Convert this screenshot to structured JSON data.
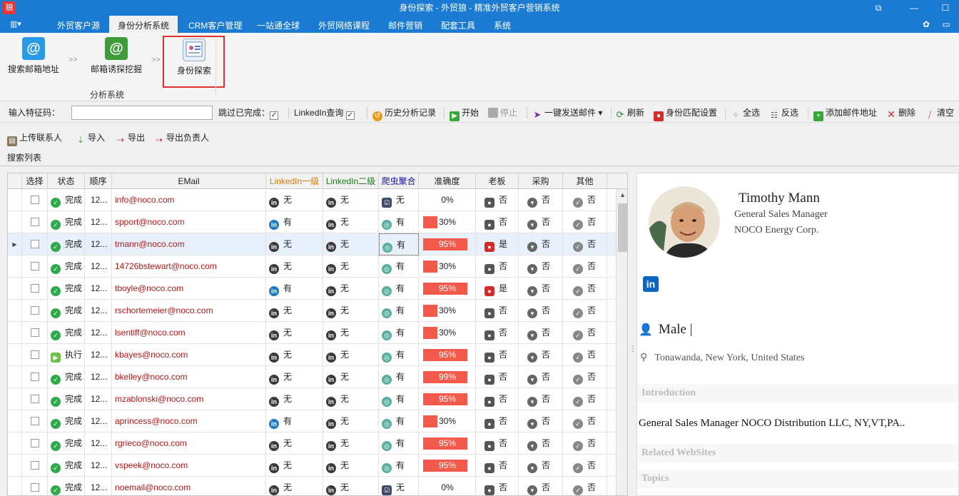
{
  "window": {
    "title": "身份探索 - 外贸狼 - 精准外贸客户营销系统",
    "logo_char": "狼"
  },
  "menu": [
    "外贸客户源",
    "身份分析系统",
    "CRM客户管理",
    "一站通全球",
    "外贸网络课程",
    "邮件营销",
    "配套工具",
    "系统"
  ],
  "ribbon": {
    "buttons": [
      "搜索邮箱地址",
      "邮箱诱探挖掘",
      "身份探索"
    ],
    "group_label": "分析系统",
    "separator": ">>"
  },
  "toolbar": {
    "feature_label": "输入特征码：",
    "feature_value": "",
    "skip_done": "跳过已完成：",
    "linkedin_query": "LinkedIn查询",
    "history": "历史分析记录",
    "start": "开始",
    "stop": "停止",
    "send_mail": "一键发送邮件",
    "refresh": "刷新",
    "identity_settings": "身份匹配设置",
    "select_all": "全选",
    "invert": "反选",
    "add_email": "添加邮件地址",
    "delete": "删除",
    "clear": "清空"
  },
  "toolbar2": {
    "upload": "上传联系人",
    "import": "导入",
    "export": "导出",
    "export_owner": "导出负责人"
  },
  "list_label": "搜索列表",
  "columns": [
    "选择",
    "状态",
    "顺序",
    "EMail",
    "LinkedIn一级",
    "LinkedIn二级",
    "爬虫聚合",
    "准确度",
    "老板",
    "采购",
    "其他"
  ],
  "colors": {
    "titlebar": "#1b7ad1",
    "accuracy_bar": "#f35a4b",
    "linkedin_l1_header": "#e07b00",
    "linkedin_l2_header": "#1a7a1a",
    "crawler_header": "#1010a0"
  },
  "rows": [
    {
      "status": "完成",
      "order": "12...",
      "email": "info@noco.com",
      "li1": "无",
      "li2": "无",
      "crawler": "无",
      "accuracy": "0%",
      "acc": 0,
      "boss": "否",
      "purchase": "否",
      "other": "否"
    },
    {
      "status": "完成",
      "order": "12...",
      "email": "spport@noco.com",
      "li1": "有",
      "li2": "无",
      "crawler": "有",
      "accuracy": "30%",
      "acc": 30,
      "boss": "否",
      "purchase": "否",
      "other": "否"
    },
    {
      "status": "完成",
      "order": "12...",
      "email": "tmann@noco.com",
      "li1": "无",
      "li2": "无",
      "crawler": "有",
      "accuracy": "95%",
      "acc": 95,
      "boss": "是",
      "purchase": "否",
      "other": "否"
    },
    {
      "status": "完成",
      "order": "12...",
      "email": "14726bstewart@noco.com",
      "li1": "无",
      "li2": "无",
      "crawler": "有",
      "accuracy": "30%",
      "acc": 30,
      "boss": "否",
      "purchase": "否",
      "other": "否"
    },
    {
      "status": "完成",
      "order": "12...",
      "email": "tboyle@noco.com",
      "li1": "有",
      "li2": "无",
      "crawler": "有",
      "accuracy": "95%",
      "acc": 95,
      "boss": "是",
      "purchase": "否",
      "other": "否"
    },
    {
      "status": "完成",
      "order": "12...",
      "email": "rschortemeier@noco.com",
      "li1": "无",
      "li2": "无",
      "crawler": "有",
      "accuracy": "30%",
      "acc": 30,
      "boss": "否",
      "purchase": "否",
      "other": "否"
    },
    {
      "status": "完成",
      "order": "12...",
      "email": "lsentiff@noco.com",
      "li1": "无",
      "li2": "无",
      "crawler": "有",
      "accuracy": "30%",
      "acc": 30,
      "boss": "否",
      "purchase": "否",
      "other": "否"
    },
    {
      "status": "执行",
      "order": "12...",
      "email": "kbayes@noco.com",
      "li1": "无",
      "li2": "无",
      "crawler": "有",
      "accuracy": "95%",
      "acc": 95,
      "boss": "否",
      "purchase": "否",
      "other": "否"
    },
    {
      "status": "完成",
      "order": "12...",
      "email": "bkelley@noco.com",
      "li1": "无",
      "li2": "无",
      "crawler": "有",
      "accuracy": "99%",
      "acc": 99,
      "boss": "否",
      "purchase": "否",
      "other": "否"
    },
    {
      "status": "完成",
      "order": "12...",
      "email": "mzablonski@noco.com",
      "li1": "无",
      "li2": "无",
      "crawler": "有",
      "accuracy": "95%",
      "acc": 95,
      "boss": "否",
      "purchase": "否",
      "other": "否"
    },
    {
      "status": "完成",
      "order": "12...",
      "email": "aprincess@noco.com",
      "li1": "有",
      "li2": "无",
      "crawler": "有",
      "accuracy": "30%",
      "acc": 30,
      "boss": "否",
      "purchase": "否",
      "other": "否"
    },
    {
      "status": "完成",
      "order": "12...",
      "email": "rgrieco@noco.com",
      "li1": "无",
      "li2": "无",
      "crawler": "有",
      "accuracy": "95%",
      "acc": 95,
      "boss": "否",
      "purchase": "否",
      "other": "否"
    },
    {
      "status": "完成",
      "order": "12...",
      "email": "vspeek@noco.com",
      "li1": "无",
      "li2": "无",
      "crawler": "有",
      "accuracy": "95%",
      "acc": 95,
      "boss": "否",
      "purchase": "否",
      "other": "否"
    },
    {
      "status": "完成",
      "order": "12...",
      "email": "noemail@noco.com",
      "li1": "无",
      "li2": "无",
      "crawler": "无",
      "accuracy": "0%",
      "acc": 0,
      "boss": "否",
      "purchase": "否",
      "other": "否"
    }
  ],
  "profile": {
    "name": "Timothy Mann",
    "title": "General Sales Manager",
    "company": "NOCO Energy Corp.",
    "linkedin": "in",
    "gender": "Male |",
    "location": "Tonawanda, New York, United States",
    "sections": [
      "Introduction",
      "Related WebSites",
      "Topics"
    ],
    "introduction": "General Sales Manager NOCO Distribution LLC, NY,VT,PA.."
  }
}
